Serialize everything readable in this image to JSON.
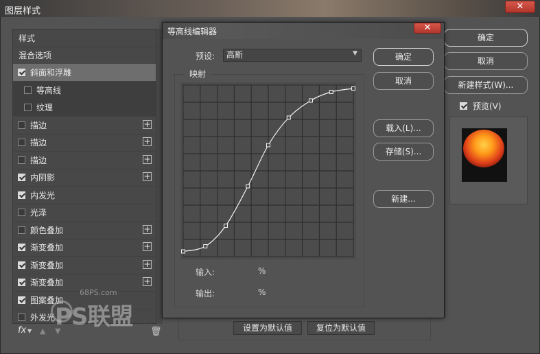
{
  "layer_style": {
    "title": "图层样式",
    "close_label": "✕",
    "list_header": "样式",
    "blend_options": "混合选项",
    "items": [
      {
        "label": "斜面和浮雕",
        "checked": true,
        "selected": true,
        "sub": false,
        "plus": false
      },
      {
        "label": "等高线",
        "checked": false,
        "selected": false,
        "sub": true,
        "plus": false
      },
      {
        "label": "纹理",
        "checked": false,
        "selected": false,
        "sub": true,
        "plus": false
      },
      {
        "label": "描边",
        "checked": false,
        "selected": false,
        "sub": false,
        "plus": true
      },
      {
        "label": "描边",
        "checked": false,
        "selected": false,
        "sub": false,
        "plus": true
      },
      {
        "label": "描边",
        "checked": false,
        "selected": false,
        "sub": false,
        "plus": true
      },
      {
        "label": "内阴影",
        "checked": true,
        "selected": false,
        "sub": false,
        "plus": true
      },
      {
        "label": "内发光",
        "checked": true,
        "selected": false,
        "sub": false,
        "plus": false
      },
      {
        "label": "光泽",
        "checked": false,
        "selected": false,
        "sub": false,
        "plus": false
      },
      {
        "label": "颜色叠加",
        "checked": false,
        "selected": false,
        "sub": false,
        "plus": true
      },
      {
        "label": "渐变叠加",
        "checked": true,
        "selected": false,
        "sub": false,
        "plus": true
      },
      {
        "label": "渐变叠加",
        "checked": true,
        "selected": false,
        "sub": false,
        "plus": true
      },
      {
        "label": "渐变叠加",
        "checked": true,
        "selected": false,
        "sub": false,
        "plus": true
      },
      {
        "label": "图案叠加",
        "checked": true,
        "selected": false,
        "sub": false,
        "plus": false
      },
      {
        "label": "外发光",
        "checked": false,
        "selected": false,
        "sub": false,
        "plus": false
      }
    ],
    "plus_symbol": "+",
    "fx_label": "fx",
    "fx_arrow": "▼",
    "up_arrow": "▲",
    "down_arrow": "▼",
    "trash_icon": "🗑",
    "ok": "确定",
    "cancel": "取消",
    "new_style": "新建样式(W)...",
    "preview_label": "预览(V)",
    "preview_checked": true,
    "set_default": "设置为默认值",
    "reset_default": "复位为默认值"
  },
  "watermark": {
    "url": "68PS.com",
    "logo_text": "PS联盟"
  },
  "contour_editor": {
    "title": "等高线编辑器",
    "close_label": "✕",
    "preset_label": "预设:",
    "preset_value": "高斯",
    "mapping_label": "映射",
    "input_label": "输入:",
    "input_unit": "%",
    "output_label": "输出:",
    "output_unit": "%",
    "ok": "确定",
    "cancel": "取消",
    "load": "载入(L)...",
    "save": "存储(S)...",
    "new": "新建...",
    "grid_divisions": 10,
    "curve_points": [
      {
        "input": 0,
        "output": 3
      },
      {
        "input": 13,
        "output": 6
      },
      {
        "input": 25,
        "output": 18
      },
      {
        "input": 38,
        "output": 41
      },
      {
        "input": 50,
        "output": 65
      },
      {
        "input": 62,
        "output": 81
      },
      {
        "input": 75,
        "output": 91
      },
      {
        "input": 87,
        "output": 96
      },
      {
        "input": 100,
        "output": 98
      }
    ]
  }
}
